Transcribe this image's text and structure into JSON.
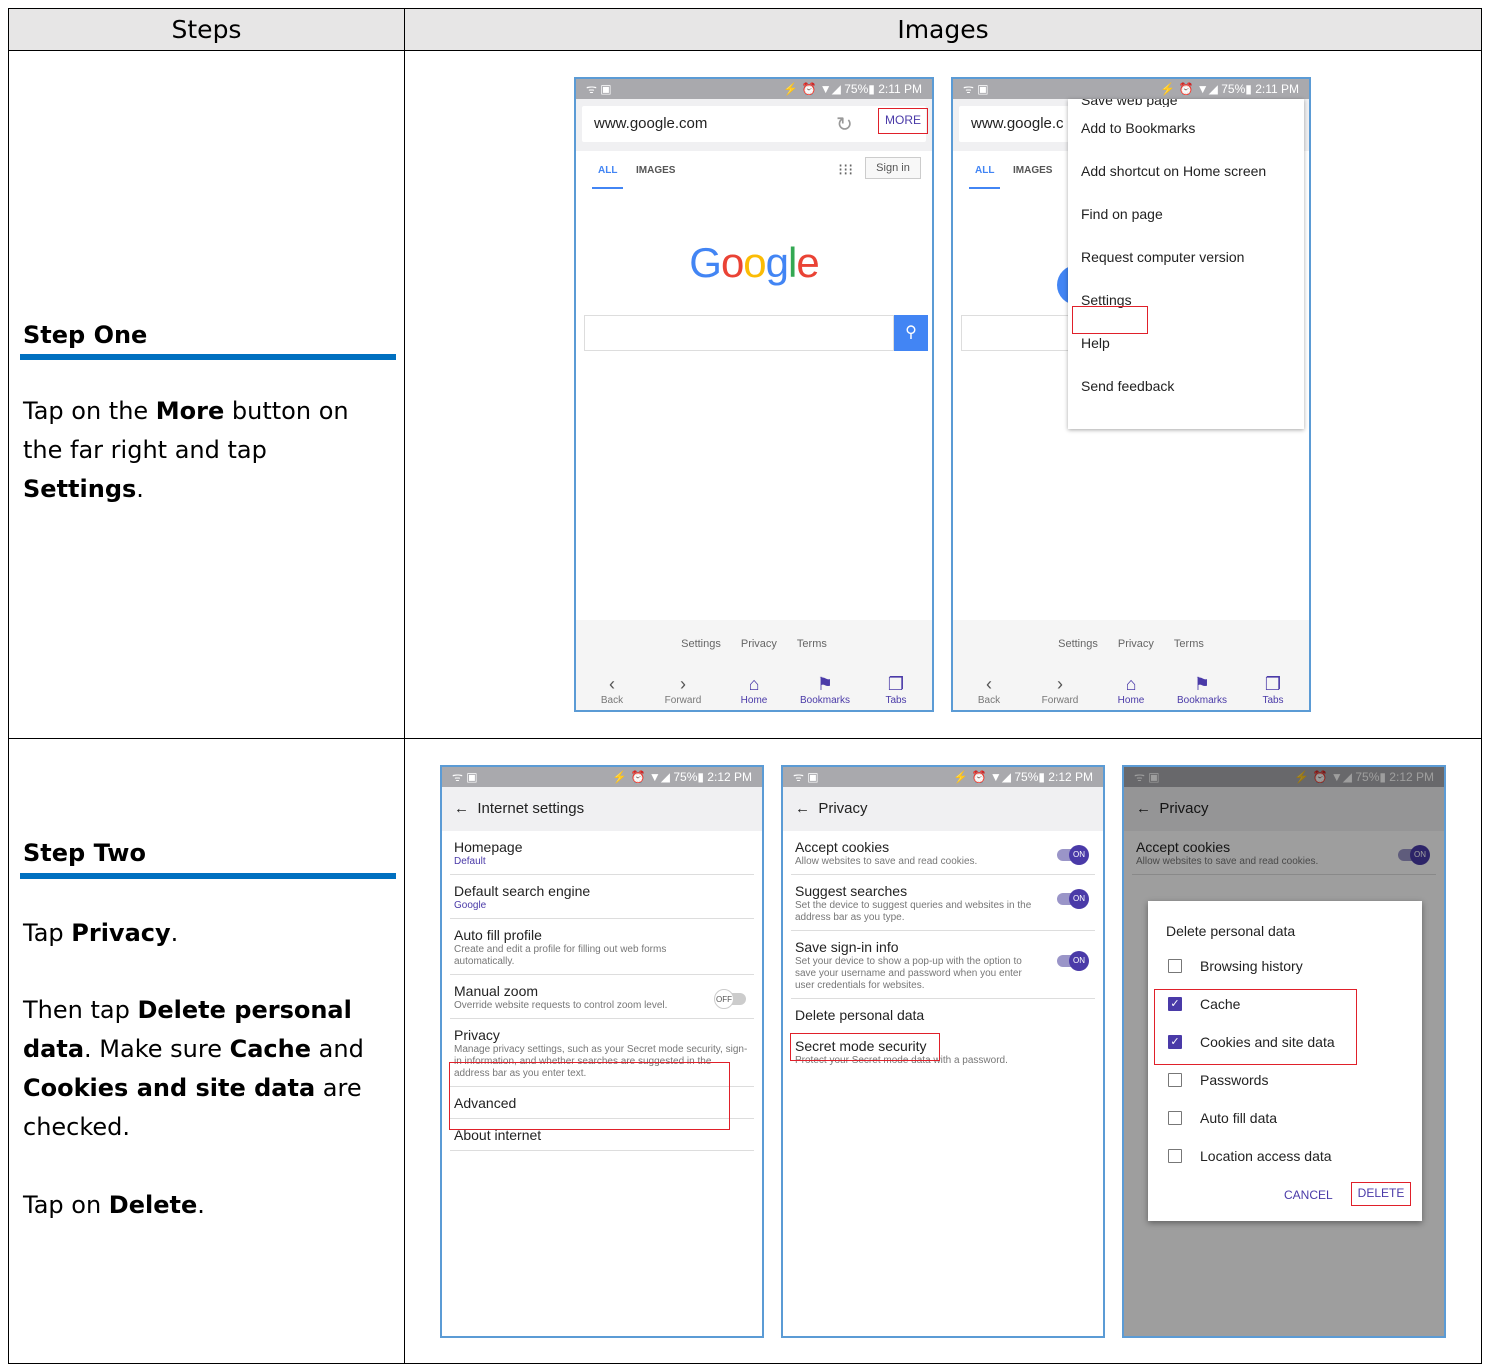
{
  "table": {
    "header_steps": "Steps",
    "header_images": "Images"
  },
  "step_one": {
    "title": "Step One",
    "text_pre": "Tap on the ",
    "text_b1": "More",
    "text_mid": " button on the far right and tap ",
    "text_b2": "Settings",
    "text_post": "."
  },
  "step_two": {
    "title": "Step Two",
    "p1_pre": "Tap ",
    "p1_b": "Privacy",
    "p1_post": ".",
    "p2_pre": "Then tap ",
    "p2_b1": "Delete personal data",
    "p2_mid1": ". Make sure ",
    "p2_b2": "Cache",
    "p2_mid2": " and ",
    "p2_b3": "Cookies and site data",
    "p2_post": " are checked.",
    "p3_pre": "Tap on ",
    "p3_b": "Delete",
    "p3_post": "."
  },
  "status": {
    "left": "ᯤ ▣",
    "right_211": "⚡ ⏰ ▼◢ 75%▮ 2:11 PM",
    "right_212": "⚡ ⏰ ▼◢ 75%▮ 2:12 PM"
  },
  "browser": {
    "url": "www.google.com",
    "url_cut": "www.google.c",
    "more": "MORE",
    "tab_all": "ALL",
    "tab_images": "IMAGES",
    "sign_in": "Sign in",
    "logo": [
      "G",
      "o",
      "o",
      "g",
      "l",
      "e"
    ],
    "logo_colors": [
      "#4285f4",
      "#ea4335",
      "#fbbc05",
      "#4285f4",
      "#34a853",
      "#ea4335"
    ],
    "footer_links": [
      "Settings",
      "Privacy",
      "Terms"
    ],
    "nav": [
      {
        "icon": "‹",
        "label": "Back"
      },
      {
        "icon": "›",
        "label": "Forward"
      },
      {
        "icon": "⌂",
        "label": "Home"
      },
      {
        "icon": "⚑",
        "label": "Bookmarks"
      },
      {
        "icon": "❐",
        "label": "Tabs"
      }
    ]
  },
  "menu": {
    "items": [
      "Save web page",
      "Add to Bookmarks",
      "Add shortcut on Home screen",
      "Find on page",
      "Request computer version",
      "Settings",
      "Help",
      "Send feedback"
    ]
  },
  "internet_settings": {
    "title": "Internet settings",
    "items": [
      {
        "t": "Homepage",
        "s": "Default"
      },
      {
        "t": "Default search engine",
        "s": "Google"
      },
      {
        "t": "Auto fill profile",
        "s": "Create and edit a profile for filling out web forms automatically."
      },
      {
        "t": "Manual zoom",
        "s": "Override website requests to control zoom level."
      },
      {
        "t": "Privacy",
        "s": "Manage privacy settings, such as your Secret mode security, sign-in information, and whether searches are suggested in the address bar as you enter text."
      },
      {
        "t": "Advanced",
        "s": ""
      },
      {
        "t": "About internet",
        "s": ""
      }
    ],
    "toggle_off": "OFF"
  },
  "privacy": {
    "title": "Privacy",
    "items": [
      {
        "t": "Accept cookies",
        "s": "Allow websites to save and read cookies."
      },
      {
        "t": "Suggest searches",
        "s": "Set the device to suggest queries and websites in the address bar as you type."
      },
      {
        "t": "Save sign-in info",
        "s": "Set your device to show a pop-up with the option to save your username and password when you enter user credentials for websites."
      },
      {
        "t": "Delete personal data",
        "s": ""
      },
      {
        "t": "Secret mode security",
        "s": "Protect your Secret mode data with a password."
      }
    ],
    "toggle_on": "ON"
  },
  "dialog": {
    "title": "Delete personal data",
    "options": [
      {
        "label": "Browsing history",
        "checked": false
      },
      {
        "label": "Cache",
        "checked": true
      },
      {
        "label": "Cookies and site data",
        "checked": true
      },
      {
        "label": "Passwords",
        "checked": false
      },
      {
        "label": "Auto fill data",
        "checked": false
      },
      {
        "label": "Location access data",
        "checked": false
      }
    ],
    "cancel": "CANCEL",
    "delete": "DELETE",
    "check_mark": "✓"
  },
  "colors": {
    "frame": "#5b9bd5",
    "accent": "#4a3aa8",
    "highlight": "#e0202a",
    "step_bar": "#0070c0",
    "header_bg": "#e7e6e6"
  }
}
